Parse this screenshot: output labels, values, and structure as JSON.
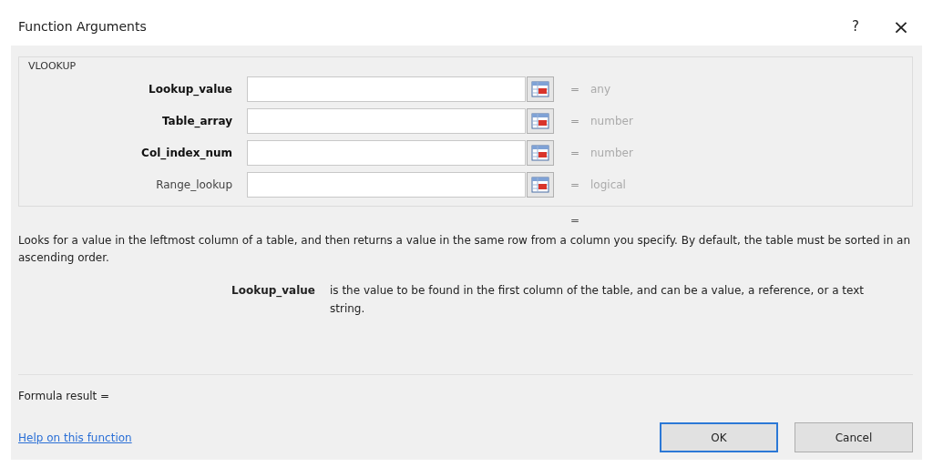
{
  "window": {
    "title": "Function Arguments",
    "help_glyph": "?",
    "close_glyph": "×"
  },
  "function_name": "VLOOKUP",
  "arguments": [
    {
      "label": "Lookup_value",
      "required": true,
      "equals": "=",
      "result": "any"
    },
    {
      "label": "Table_array",
      "required": true,
      "equals": "=",
      "result": "number"
    },
    {
      "label": "Col_index_num",
      "required": true,
      "equals": "=",
      "result": "number"
    },
    {
      "label": "Range_lookup",
      "required": false,
      "equals": "=",
      "result": "logical"
    }
  ],
  "function_result_equals": "=",
  "description": "Looks for a value in the leftmost column of a table, and then returns a value in the same row from a column you specify. By default, the table must be sorted in an ascending order.",
  "argument_help": {
    "label": "Lookup_value",
    "text": "is the value to be found in the first column of the table, and can be a value, a reference, or a text string."
  },
  "formula_result": "Formula result =",
  "help_link": "Help on this function",
  "buttons": [
    {
      "label": "OK",
      "default": true
    },
    {
      "label": "Cancel",
      "default": false
    }
  ]
}
